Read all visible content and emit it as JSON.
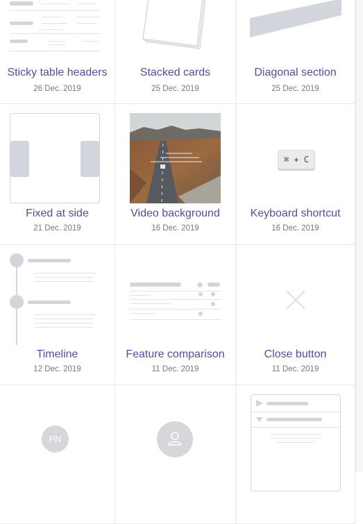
{
  "items": [
    {
      "title": "Sticky table headers",
      "date": "26 Dec. 2019",
      "icon": "sticky-table-headers-thumb"
    },
    {
      "title": "Stacked cards",
      "date": "25 Dec. 2019",
      "icon": "stacked-cards-thumb"
    },
    {
      "title": "Diagonal section",
      "date": "25 Dec. 2019",
      "icon": "diagonal-section-thumb"
    },
    {
      "title": "Fixed at side",
      "date": "21 Dec. 2019",
      "icon": "fixed-at-side-thumb"
    },
    {
      "title": "Video background",
      "date": "16 Dec. 2019",
      "icon": "video-background-thumb"
    },
    {
      "title": "Keyboard shortcut",
      "date": "16 Dec. 2019",
      "icon": "keyboard-shortcut-thumb",
      "key_label": "⌘ + C"
    },
    {
      "title": "Timeline",
      "date": "12 Dec. 2019",
      "icon": "timeline-thumb"
    },
    {
      "title": "Feature comparison",
      "date": "11 Dec. 2019",
      "icon": "feature-comparison-thumb"
    },
    {
      "title": "Close button",
      "date": "11 Dec. 2019",
      "icon": "close-icon"
    },
    {
      "title": "",
      "date": "",
      "icon": "avatar-initials-thumb",
      "avatar_initials": "PN"
    },
    {
      "title": "",
      "date": "",
      "icon": "avatar-user-thumb"
    },
    {
      "title": "",
      "date": "",
      "icon": "accordion-thumb"
    }
  ],
  "colors": {
    "title": "#4f4fa0",
    "date": "#777780",
    "placeholder": "#d3d5dc",
    "divider": "#e6e6ea"
  }
}
